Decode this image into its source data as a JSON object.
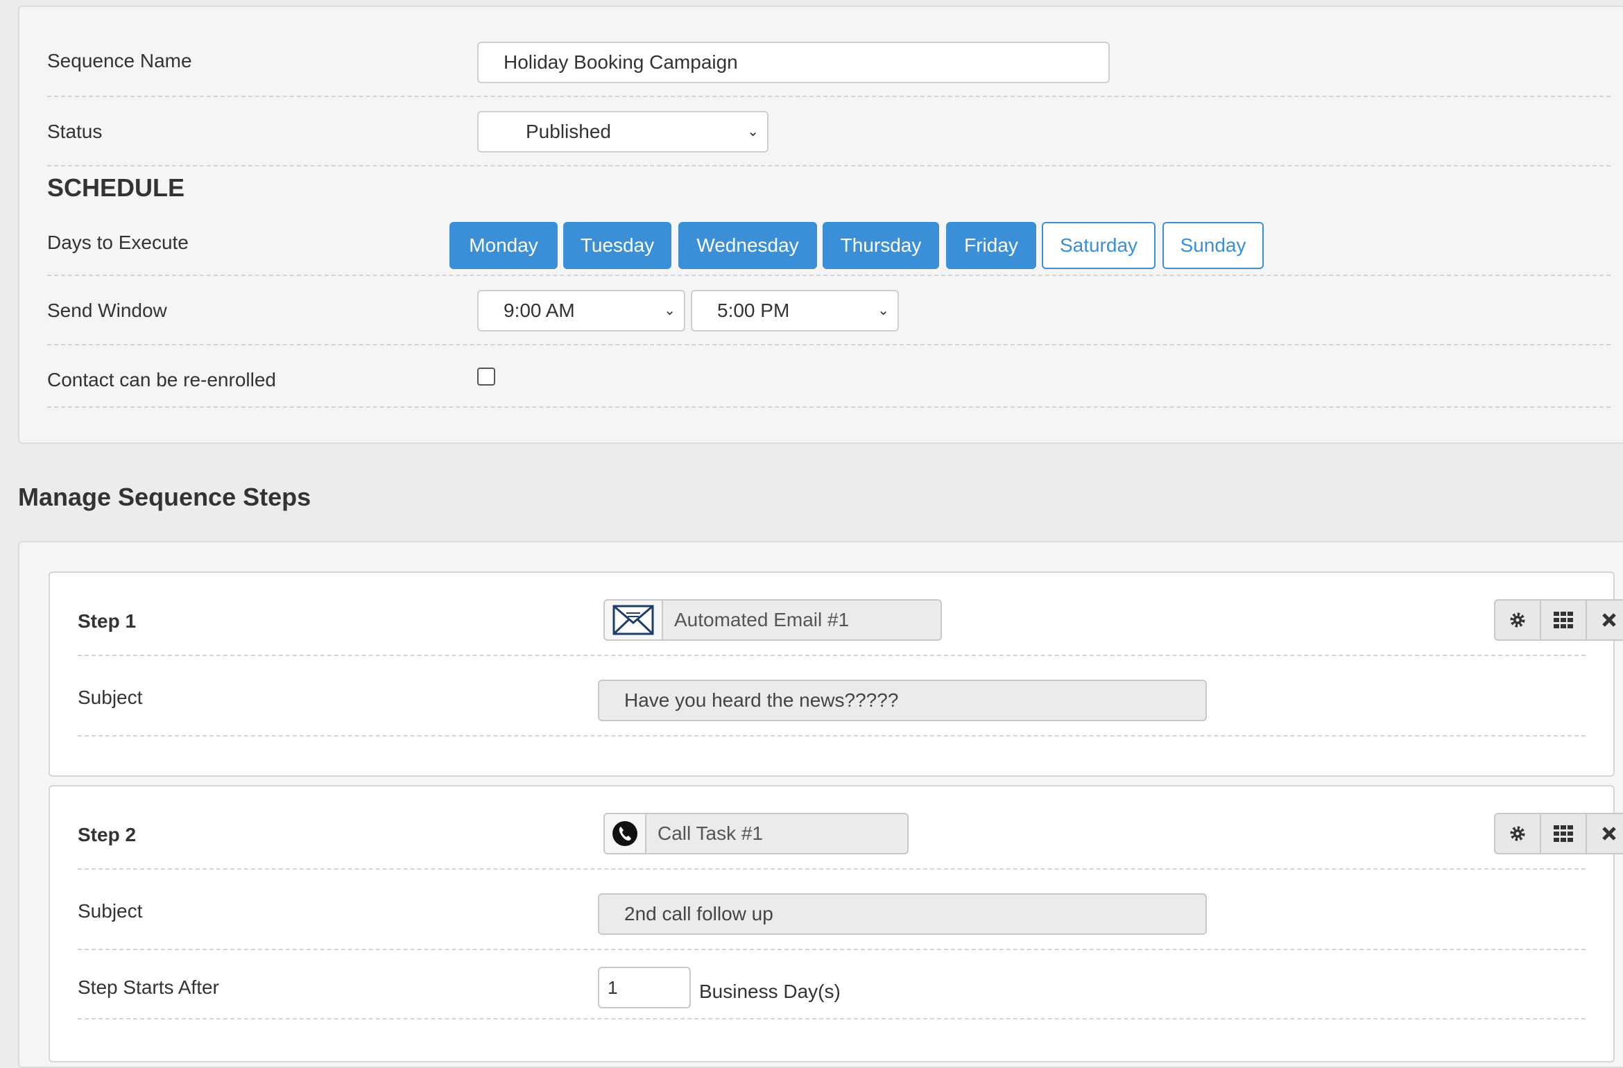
{
  "settings": {
    "sequence_name": {
      "label": "Sequence Name",
      "value": "Holiday Booking Campaign"
    },
    "status": {
      "label": "Status",
      "value": "Published"
    },
    "schedule_heading": "SCHEDULE",
    "days": {
      "label": "Days to Execute",
      "items": [
        {
          "label": "Monday",
          "selected": true
        },
        {
          "label": "Tuesday",
          "selected": true
        },
        {
          "label": "Wednesday",
          "selected": true
        },
        {
          "label": "Thursday",
          "selected": true
        },
        {
          "label": "Friday",
          "selected": true
        },
        {
          "label": "Saturday",
          "selected": false
        },
        {
          "label": "Sunday",
          "selected": false
        }
      ]
    },
    "send_window": {
      "label": "Send Window",
      "start": "9:00 AM",
      "end": "5:00 PM"
    },
    "reenroll": {
      "label": "Contact can be re-enrolled",
      "checked": false
    }
  },
  "steps": {
    "heading": "Manage Sequence Steps",
    "items": [
      {
        "title": "Step 1",
        "type_icon": "envelope-icon",
        "type_name": "Automated Email #1",
        "subject_label": "Subject",
        "subject": "Have you heard the news?????"
      },
      {
        "title": "Step 2",
        "type_icon": "phone-icon",
        "type_name": "Call Task #1",
        "subject_label": "Subject",
        "subject": "2nd call follow up",
        "starts_after_label": "Step Starts After",
        "starts_after_value": "1",
        "starts_after_unit": "Business Day(s)"
      }
    ]
  },
  "colors": {
    "accent": "#3a8fd6",
    "panel_bg": "#f5f5f5",
    "page_bg": "#ececec"
  },
  "icons": {
    "settings": "gear-icon",
    "reorder": "grid-icon",
    "remove": "close-icon"
  }
}
